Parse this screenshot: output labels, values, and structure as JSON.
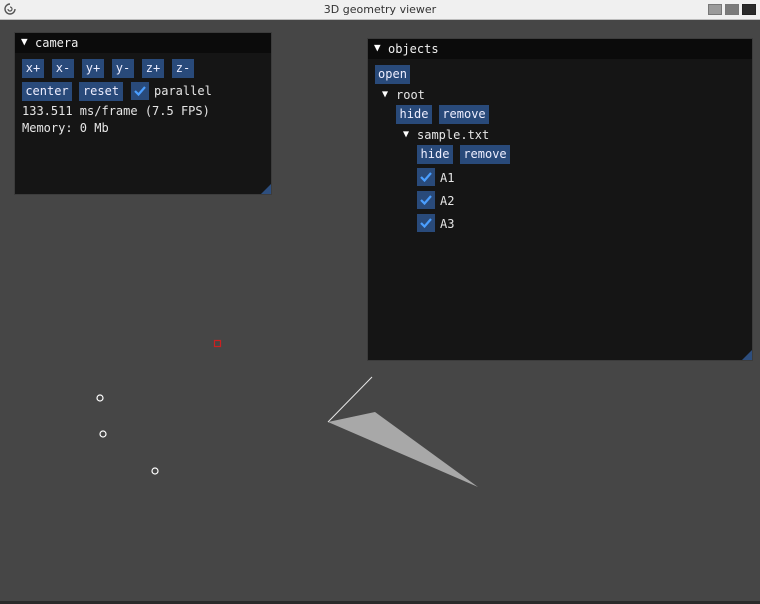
{
  "window": {
    "title": "3D geometry viewer"
  },
  "camera_panel": {
    "title": "camera",
    "buttons": {
      "x_plus": "x+",
      "x_minus": "x-",
      "y_plus": "y+",
      "y_minus": "y-",
      "z_plus": "z+",
      "z_minus": "z-",
      "center": "center",
      "reset": "reset"
    },
    "parallel_label": "parallel",
    "parallel_checked": true,
    "frame_stats": "133.511 ms/frame (7.5 FPS)",
    "memory": "Memory: 0 Mb"
  },
  "objects_panel": {
    "title": "objects",
    "open_label": "open",
    "root": {
      "label": "root",
      "hide_label": "hide",
      "remove_label": "remove",
      "file": {
        "label": "sample.txt",
        "hide_label": "hide",
        "remove_label": "remove",
        "items": [
          {
            "label": "A1",
            "checked": true
          },
          {
            "label": "A2",
            "checked": true
          },
          {
            "label": "A3",
            "checked": true
          }
        ]
      }
    }
  },
  "colors": {
    "background": "#464646",
    "panel": "#151515",
    "button": "#294a7a",
    "check": "#4a9eff",
    "selected_point": "#cc2020",
    "triangle": "#a8a8a8"
  }
}
